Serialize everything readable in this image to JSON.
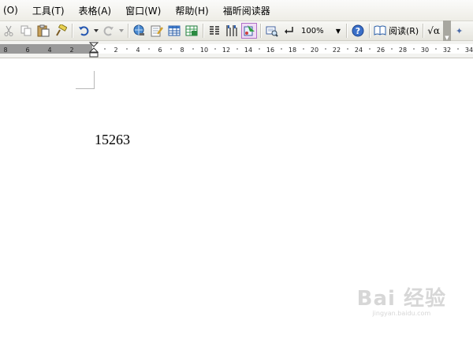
{
  "menu": [
    {
      "label": "(O)"
    },
    {
      "label": "工具(T)"
    },
    {
      "label": "表格(A)"
    },
    {
      "label": "窗口(W)"
    },
    {
      "label": "帮助(H)"
    },
    {
      "label": "福昕阅读器"
    }
  ],
  "toolbar": {
    "zoom_value": "100%",
    "read_label": "阅读(R)",
    "formula_label": "√α"
  },
  "ruler": {
    "left_ticks": [
      "8",
      "6",
      "4",
      "2"
    ],
    "right_ticks": [
      "2",
      "4",
      "6",
      "8",
      "10",
      "12",
      "14",
      "16",
      "18",
      "20",
      "22",
      "24",
      "26",
      "28",
      "30",
      "32",
      "34"
    ]
  },
  "document": {
    "text": "15263"
  },
  "watermark": {
    "main": "Bai 经验",
    "sub": "jingyan.baidu.com"
  },
  "colors": {
    "active_button_border": "#b070c8",
    "ruler_margin": "#9a9a9a"
  }
}
